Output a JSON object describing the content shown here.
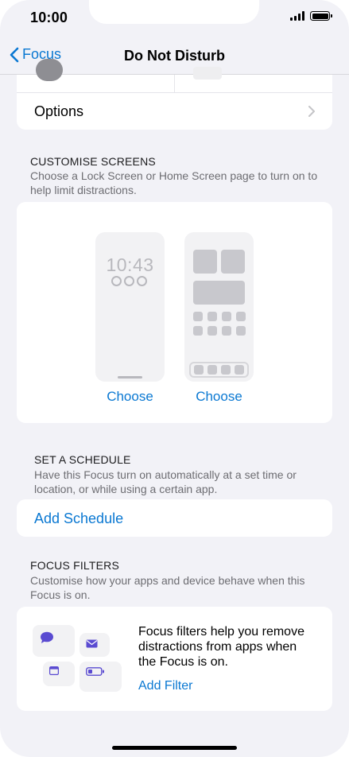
{
  "status_bar": {
    "time": "10:00"
  },
  "nav": {
    "back_label": "Focus",
    "title": "Do Not Disturb"
  },
  "options": {
    "label": "Options"
  },
  "customise_screens": {
    "heading": "CUSTOMISE SCREENS",
    "description": "Choose a Lock Screen or Home Screen page to turn on to help limit distractions.",
    "lock_preview_time": "10:43",
    "lock_choose_label": "Choose",
    "home_choose_label": "Choose"
  },
  "schedule": {
    "heading": "SET A SCHEDULE",
    "description": "Have this Focus turn on automatically at a set time or location, or while using a certain app.",
    "add_label": "Add Schedule"
  },
  "focus_filters": {
    "heading": "FOCUS FILTERS",
    "description": "Customise how your apps and device behave when this Focus is on.",
    "info_text": "Focus filters help you remove distractions from apps when the Focus is on.",
    "add_label": "Add Filter",
    "icons": [
      "message-icon",
      "mail-icon",
      "calendar-icon",
      "battery-icon"
    ],
    "icon_color": "#5a4bd1"
  },
  "colors": {
    "accent": "#0a78d2",
    "background": "#f2f2f7"
  }
}
